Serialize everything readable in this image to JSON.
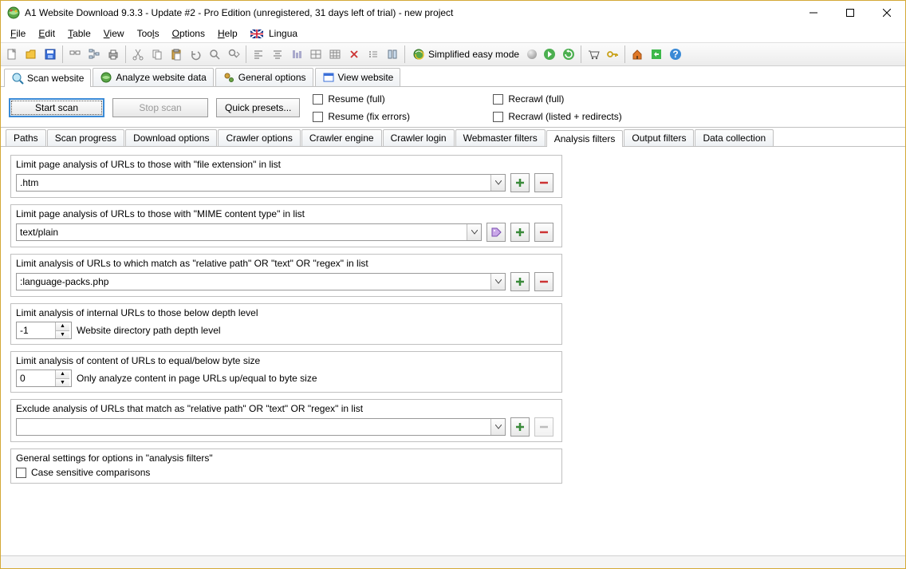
{
  "title": "A1 Website Download 9.3.3 - Update #2 - Pro Edition (unregistered, 31 days left of trial) - new project",
  "menu": {
    "file": "File",
    "edit": "Edit",
    "table": "Table",
    "view": "View",
    "tools": "Tools",
    "options": "Options",
    "help": "Help",
    "lingua": "Lingua"
  },
  "toolbar": {
    "simplified": "Simplified easy mode"
  },
  "main_tabs": {
    "scan": "Scan website",
    "analyze": "Analyze website data",
    "general": "General options",
    "view": "View website"
  },
  "controls": {
    "start": "Start scan",
    "stop": "Stop scan",
    "presets": "Quick presets...",
    "resume_full": "Resume (full)",
    "resume_fix": "Resume (fix errors)",
    "recrawl_full": "Recrawl (full)",
    "recrawl_listed": "Recrawl (listed + redirects)"
  },
  "sub_tabs": [
    "Paths",
    "Scan progress",
    "Download options",
    "Crawler options",
    "Crawler engine",
    "Crawler login",
    "Webmaster filters",
    "Analysis filters",
    "Output filters",
    "Data collection"
  ],
  "active_sub_tab": 7,
  "panels": {
    "p1": {
      "title": "Limit page analysis of URLs to those with \"file extension\" in list",
      "value": ".htm"
    },
    "p2": {
      "title": "Limit page analysis of URLs to those with \"MIME content type\" in list",
      "value": "text/plain"
    },
    "p3": {
      "title": "Limit analysis of URLs to which match as \"relative path\" OR \"text\" OR \"regex\" in list",
      "value": ":language-packs.php"
    },
    "p4": {
      "title": "Limit analysis of internal URLs to those below depth level",
      "value": "-1",
      "hint": "Website directory path depth level"
    },
    "p5": {
      "title": "Limit analysis of content of URLs to equal/below byte size",
      "value": "0",
      "hint": "Only analyze content in page URLs up/equal to byte size"
    },
    "p6": {
      "title": "Exclude analysis of URLs that match as \"relative path\" OR \"text\" OR \"regex\" in list",
      "value": ""
    },
    "p7": {
      "title": "General settings for options in \"analysis filters\"",
      "check": "Case sensitive comparisons"
    }
  }
}
